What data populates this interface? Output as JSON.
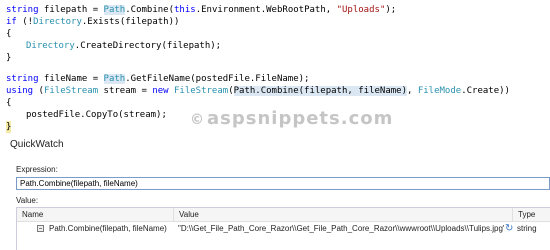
{
  "code": {
    "line1": {
      "t1": "string",
      "t2": " filepath = ",
      "t3": "Path",
      "t4": ".Combine(",
      "t5": "this",
      "t6": ".Environment.WebRootPath, ",
      "t7": "\"Uploads\"",
      "t8": ");"
    },
    "line2": {
      "t1": "if",
      "t2": " (!",
      "t3": "Directory",
      "t4": ".Exists(filepath))"
    },
    "line3": "{",
    "line4": {
      "t1": "Directory",
      "t2": ".CreateDirectory(filepath);"
    },
    "line5": "}",
    "line6": {
      "t1": "string",
      "t2": " fileName = ",
      "t3": "Path",
      "t4": ".GetFileName(postedFile.FileName);"
    },
    "line7": {
      "t1": "using",
      "t2": " (",
      "t3": "FileStream",
      "t4": " stream = ",
      "t5": "new",
      "t6": " ",
      "t7": "FileStream",
      "t8": "(",
      "t9": "Path.Combine(filepath, fileName)",
      "t10": ", ",
      "t11": "FileMode",
      "t12": ".Create))"
    },
    "line8": "{",
    "line9": "postedFile.CopyTo(stream);",
    "line10": "}"
  },
  "watermark": {
    "copyright": "©",
    "text": "aspsnippets.com"
  },
  "quickwatch": {
    "title": "QuickWatch",
    "expression_label": "Expression:",
    "expression_value": "Path.Combine(filepath, fileName)",
    "value_label": "Value:",
    "columns": {
      "name": "Name",
      "value": "Value",
      "type": "Type"
    },
    "row": {
      "name": "Path.Combine(filepath, fileName)",
      "value": "\"D:\\\\Get_File_Path_Core_Razor\\\\Get_File_Path_Core_Razor\\\\wwwroot\\\\Uploads\\\\Tulips.jpg\"",
      "type": "string",
      "name_icon": "property-icon",
      "refresh_icon": "refresh-icon"
    }
  },
  "colors": {
    "keyword": "#0000ff",
    "type": "#2b91af",
    "string": "#a31515",
    "highlight": "#dbe8f3"
  }
}
